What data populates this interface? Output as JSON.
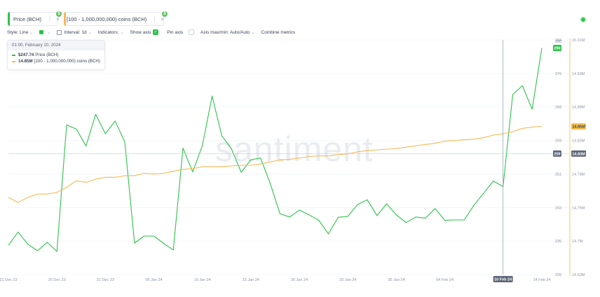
{
  "tabs": [
    {
      "label": "Price (BCH)",
      "color": "#2fc24b",
      "badge": "$",
      "badge_color": "#5cc45e"
    },
    {
      "label": "[100 - 1,000,000,000) coins (BCH)",
      "color": "#f5b955",
      "badge": "$",
      "badge_color": "#5cc45e"
    }
  ],
  "tab_menu_icon": "more-vertical-icon",
  "tab_close_icon": "close-icon",
  "status_color": "#2fc24b",
  "toolbar": {
    "style": "Style: Line",
    "interval": "Interval: 1d",
    "indicators": "Indicators:",
    "show_axis": "Show axis",
    "pin_axis": "Pin axis",
    "axis_max_min": "Axis max/min: Auto/Auto",
    "combine": "Combine metrics"
  },
  "tooltip": {
    "date": "01:00, February 10, 2024",
    "rows": [
      {
        "value": "$247.74",
        "label": "Price (BCH)",
        "color": "#2fc24b"
      },
      {
        "value": "14.85M",
        "label": "[100 - 1,000,000,000) coins (BCH)",
        "color": "#f5b955"
      }
    ]
  },
  "watermark": "santiment",
  "chart_data": {
    "type": "line",
    "x": [
      "2023-12-21",
      "2023-12-22",
      "2023-12-23",
      "2023-12-24",
      "2023-12-25",
      "2023-12-26",
      "2023-12-27",
      "2023-12-28",
      "2023-12-29",
      "2023-12-30",
      "2023-12-31",
      "2024-01-01",
      "2024-01-02",
      "2024-01-03",
      "2024-01-04",
      "2024-01-05",
      "2024-01-06",
      "2024-01-07",
      "2024-01-08",
      "2024-01-09",
      "2024-01-10",
      "2024-01-11",
      "2024-01-12",
      "2024-01-13",
      "2024-01-14",
      "2024-01-15",
      "2024-01-16",
      "2024-01-17",
      "2024-01-18",
      "2024-01-19",
      "2024-01-20",
      "2024-01-21",
      "2024-01-22",
      "2024-01-23",
      "2024-01-24",
      "2024-01-25",
      "2024-01-26",
      "2024-01-27",
      "2024-01-28",
      "2024-01-29",
      "2024-01-30",
      "2024-01-31",
      "2024-02-01",
      "2024-02-02",
      "2024-02-03",
      "2024-02-04",
      "2024-02-05",
      "2024-02-06",
      "2024-02-07",
      "2024-02-08",
      "2024-02-09",
      "2024-02-10",
      "2024-02-11",
      "2024-02-12",
      "2024-02-13",
      "2024-02-14"
    ],
    "x_ticks": [
      "21 Dec 23",
      "26 Dec 23",
      "31 Dec 23",
      "05 Jan 24",
      "10 Jan 24",
      "15 Jan 24",
      "20 Jan 24",
      "25 Jan 24",
      "30 Jan 24",
      "04 Feb 24",
      "10 Feb 24",
      "14 Feb 24"
    ],
    "series": [
      {
        "name": "Price (BCH)",
        "color": "#2fc24b",
        "axis": "left",
        "values": [
          234.0,
          237.6,
          234.3,
          232.5,
          234.8,
          232.3,
          266.8,
          265.7,
          261.1,
          269.7,
          264.4,
          267.9,
          262.2,
          234.6,
          236.5,
          236.5,
          234.5,
          232.7,
          260.5,
          254.0,
          261.2,
          274.7,
          263.9,
          260.3,
          253.9,
          257.3,
          257.8,
          250.8,
          242.6,
          241.7,
          243.6,
          242.3,
          240.8,
          237.1,
          241.6,
          241.9,
          245.1,
          246.4,
          242.1,
          245.3,
          242.3,
          240.2,
          241.7,
          241.4,
          244.0,
          240.8,
          240.9,
          240.9,
          244.9,
          248.2,
          251.5,
          250.0,
          275.1,
          277.5,
          271.1,
          287.8
        ]
      },
      {
        "name": "[100 - 1,000,000,000) coins (BCH)",
        "color": "#f5b955",
        "axis": "right",
        "values": [
          14.766,
          14.763,
          14.766,
          14.768,
          14.768,
          14.769,
          14.772,
          14.776,
          14.775,
          14.777,
          14.778,
          14.778,
          14.779,
          14.779,
          14.781,
          14.78,
          14.781,
          14.784,
          14.787,
          14.788,
          14.791,
          14.791,
          14.791,
          14.792,
          14.793,
          14.793,
          14.795,
          14.798,
          14.801,
          14.802,
          14.804,
          14.806,
          14.807,
          14.807,
          14.809,
          14.81,
          14.813,
          14.815,
          14.816,
          14.817,
          14.818,
          14.82,
          14.822,
          14.824,
          14.826,
          14.829,
          14.83,
          14.831,
          14.832,
          14.834,
          14.838,
          14.84,
          14.843,
          14.848,
          14.85,
          14.851
        ]
      }
    ],
    "left_axis": {
      "ticks": [
        226,
        235,
        243,
        251,
        259,
        268,
        276,
        284,
        290
      ],
      "min": 226,
      "max": 290
    },
    "right_axis": {
      "ticks": [
        14.63,
        14.7,
        14.76,
        14.78,
        14.83,
        14.88,
        14.93,
        15.01
      ],
      "labels": [
        "14.63M",
        "14.7M",
        "14.76M",
        "14.78M",
        "14.83M",
        "14.88M",
        "14.93M",
        "15.01M"
      ]
    },
    "markers": {
      "left_current": "290",
      "left_hover": "259",
      "right_current": "14.85M",
      "right_hover": "14.83M",
      "x_hover": "10 Feb 24"
    }
  }
}
